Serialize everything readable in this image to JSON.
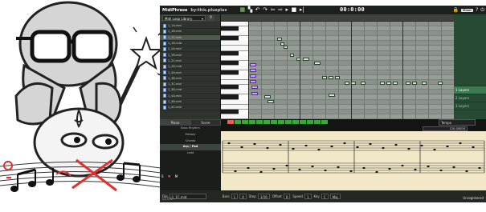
{
  "window": {
    "title": "MidiPhrase",
    "author": "by:this.plusplus",
    "timecode": "00:0:00",
    "bpm_label": "",
    "mix_badge": "Mixer"
  },
  "library": {
    "selected_pack": "Midi Loop Library",
    "files": [
      "1_1A.mid",
      "1_1B.mid",
      "1_1C.mid",
      "1_1D.mid",
      "1_2A.mid",
      "1_2B.mid",
      "1_2C.mid",
      "1_2D.mid",
      "1_3A.mid",
      "1_3B.mid",
      "1_3C.mid",
      "1_3D.mid",
      "1_4A.mid",
      "1_4B.mid",
      "1_4C.mid"
    ],
    "selected_index": 2
  },
  "layers": {
    "items": [
      "",
      "1 Layers",
      "2 Layers",
      "3 Layers"
    ],
    "selected_index": 1
  },
  "bottom": {
    "tab_piano": "Piano",
    "tab_score": "Score",
    "tracks": [
      "Bass Rhythm",
      "Melody",
      "Chords",
      "Arp / Pad",
      "Lead",
      "",
      "",
      ""
    ],
    "selected_track": 3,
    "stretch_label": "Tempo",
    "value_box": "120.00000"
  },
  "status": {
    "ver": "v2.0.0",
    "file_label": "File",
    "file_value": "1_1C.mid",
    "range_label": "Bars",
    "bars_start": "1",
    "bars_end": "4",
    "step_label": "Step",
    "step_value": "1/16",
    "offset_label": "Offset",
    "offset_value": "0",
    "speed_label": "Speed",
    "speed_value": "1",
    "key_label": "Key",
    "key_value": "C",
    "scale_value": "Maj",
    "credit": "Unregistered"
  },
  "colors": {
    "accent_green": "#3aa93a",
    "note_purple": "#c9a6f2",
    "score_paper": "#f2e7c6"
  }
}
